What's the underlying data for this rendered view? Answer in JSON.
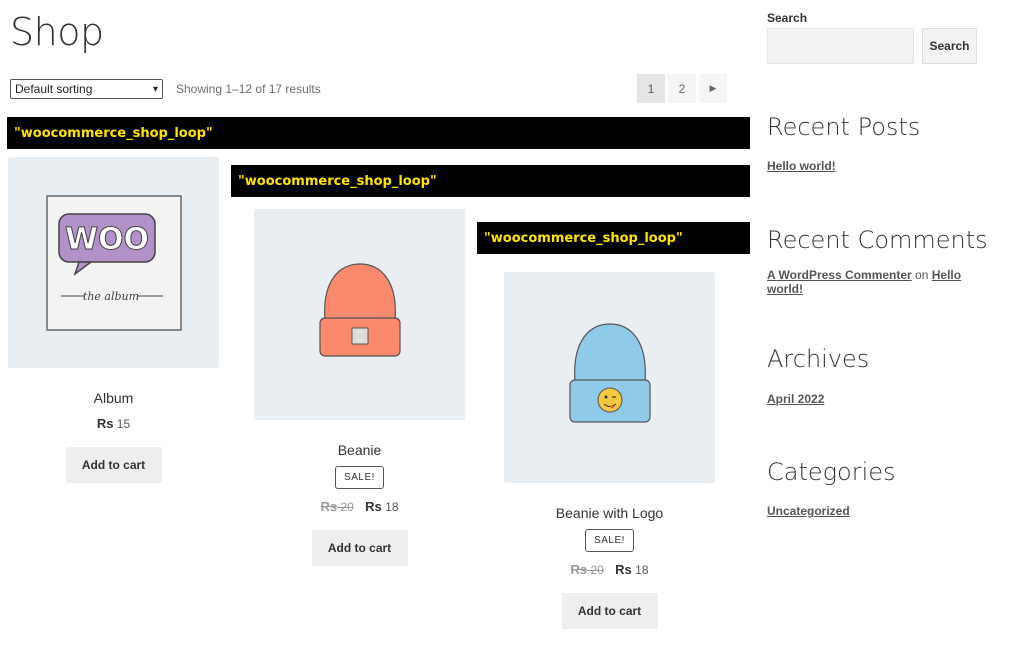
{
  "page": {
    "title": "Shop"
  },
  "toolbar": {
    "sort_selected": "Default sorting",
    "result_count": "Showing 1–12 of 17 results",
    "pages": [
      "1",
      "2"
    ],
    "next_icon": "caret-right-icon"
  },
  "hook_label": "\"woocommerce_shop_loop\"",
  "products": [
    {
      "name": "Album",
      "currency": "Rs",
      "price": "15",
      "button": "Add to cart"
    },
    {
      "name": "Beanie",
      "badge": "SALE!",
      "currency": "Rs",
      "old_price": "20",
      "price": "18",
      "button": "Add to cart"
    },
    {
      "name": "Beanie with Logo",
      "badge": "SALE!",
      "currency": "Rs",
      "old_price": "20",
      "price": "18",
      "button": "Add to cart"
    }
  ],
  "sidebar": {
    "search_label": "Search",
    "search_button": "Search",
    "recent_posts_title": "Recent Posts",
    "recent_post": "Hello world!",
    "recent_comments_title": "Recent Comments",
    "comment_author": "A WordPress Commenter",
    "comment_on": "on",
    "comment_post": "Hello world!",
    "archives_title": "Archives",
    "archive_item": "April 2022",
    "categories_title": "Categories",
    "category_item": "Uncategorized"
  },
  "colors": {
    "hook_bg": "#000000",
    "hook_text": "#ffe400",
    "thumb_bg": "#e8eef2"
  }
}
